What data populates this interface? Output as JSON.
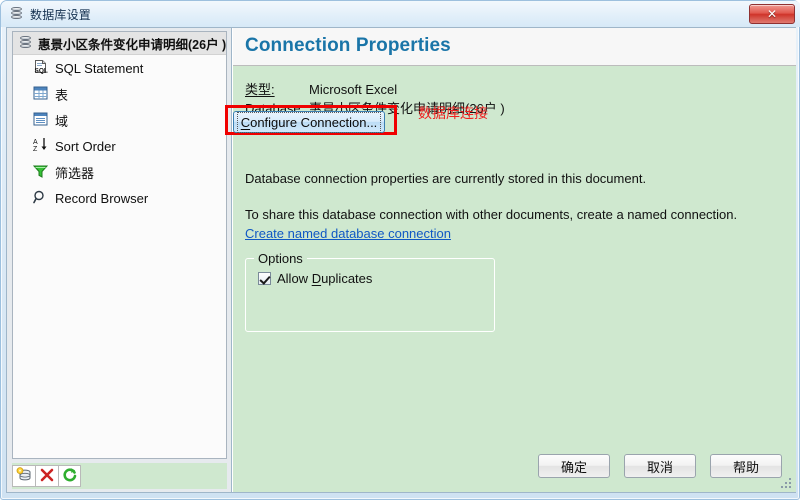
{
  "window": {
    "title": "数据库设置",
    "icon": "database-icon",
    "close_label": "✕"
  },
  "sidebar": {
    "root": {
      "label": "惠景小区条件变化申请明细(26户 )",
      "icon": "database-icon"
    },
    "items": [
      {
        "label": "SQL Statement",
        "icon": "sql-statement-icon"
      },
      {
        "label": "表",
        "icon": "table-icon"
      },
      {
        "label": "域",
        "icon": "field-icon"
      },
      {
        "label": "Sort Order",
        "icon": "sort-order-icon"
      },
      {
        "label": "筛选器",
        "icon": "filter-funnel-icon"
      },
      {
        "label": "Record Browser",
        "icon": "magnifier-icon"
      }
    ],
    "toolbar": [
      {
        "name": "add-database-button",
        "icon": "database-add-icon"
      },
      {
        "name": "delete-button",
        "icon": "red-x-icon"
      },
      {
        "name": "refresh-button",
        "icon": "green-refresh-icon"
      }
    ]
  },
  "panel": {
    "title": "Connection Properties",
    "fields": [
      {
        "key": "类型:",
        "value": "Microsoft Excel"
      },
      {
        "key": "Database:",
        "value": "惠景小区条件变化申请明细(26户 )"
      }
    ],
    "configure_button": {
      "prefix": "C",
      "rest": "onfigure Connection..."
    },
    "annotation": "数据库连接",
    "annotation_color": "#f02020",
    "paragraph_1": "Database connection properties are currently stored in this document.",
    "paragraph_2": "To share this database connection with other documents, create a named connection.",
    "link": "Create named database connection",
    "options": {
      "legend": "Options",
      "checkbox": {
        "prefix": "Allow ",
        "accel": "D",
        "rest": "uplicates",
        "checked": true
      }
    }
  },
  "footer": {
    "buttons": [
      {
        "label": "确定",
        "name": "ok-button"
      },
      {
        "label": "取消",
        "name": "cancel-button"
      },
      {
        "label": "帮助",
        "name": "help-button"
      }
    ]
  },
  "colors": {
    "panel_background": "#cfe8cf",
    "title_accent": "#1a75a8",
    "link": "#1058c4",
    "annotation": "#f02020"
  }
}
